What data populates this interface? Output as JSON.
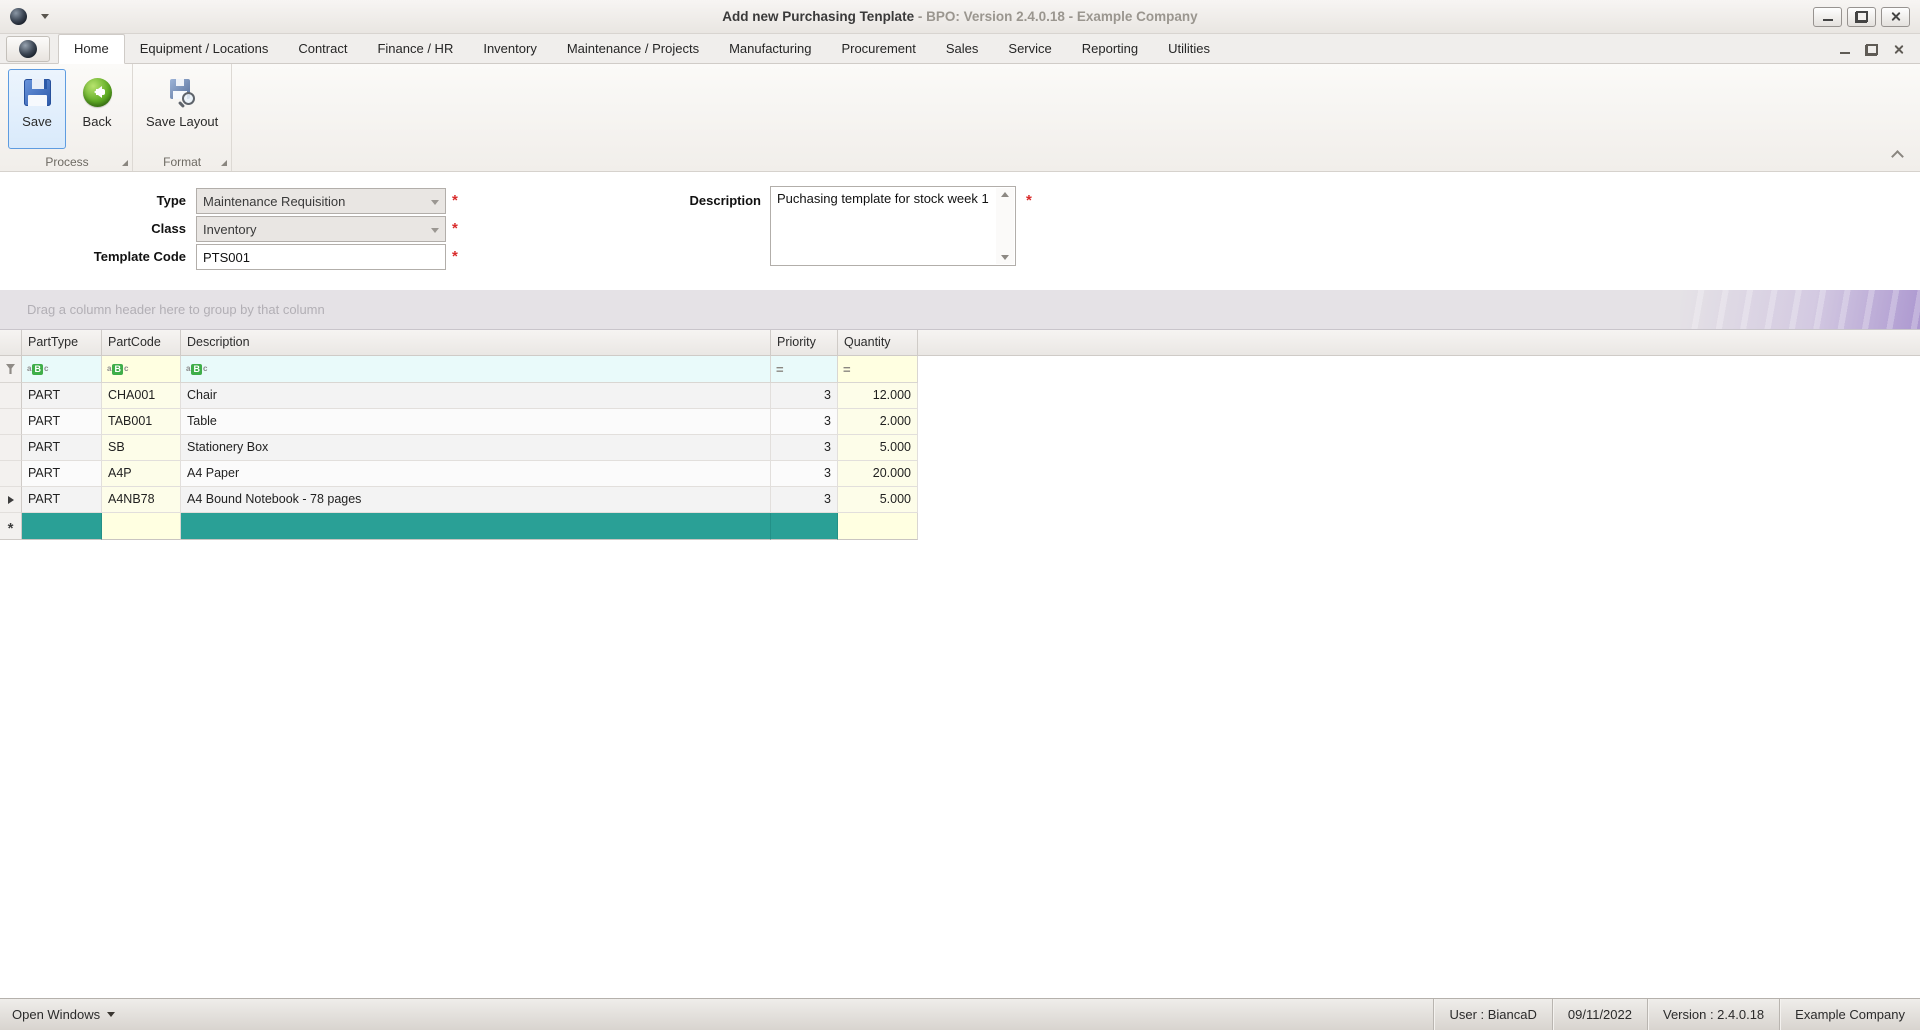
{
  "window": {
    "title_primary": "Add new Purchasing Tenplate",
    "title_secondary": " - BPO: Version 2.4.0.18 - Example Company"
  },
  "ribbon": {
    "tabs": [
      "Home",
      "Equipment / Locations",
      "Contract",
      "Finance / HR",
      "Inventory",
      "Maintenance / Projects",
      "Manufacturing",
      "Procurement",
      "Sales",
      "Service",
      "Reporting",
      "Utilities"
    ],
    "buttons": {
      "save": "Save",
      "back": "Back",
      "save_layout": "Save Layout"
    },
    "groups": {
      "process": "Process",
      "format": "Format"
    }
  },
  "form": {
    "type": {
      "label": "Type",
      "value": "Maintenance Requisition"
    },
    "class": {
      "label": "Class",
      "value": "Inventory"
    },
    "template_code": {
      "label": "Template Code",
      "value": "PTS001"
    },
    "description": {
      "label": "Description",
      "value": "Puchasing template for stock week 1"
    },
    "required_marker": "*"
  },
  "grid": {
    "group_by_hint": "Drag a column header here to group by that column",
    "columns": [
      "PartType",
      "PartCode",
      "Description",
      "Priority",
      "Quantity"
    ],
    "filter": {
      "text_glyph_a": "a",
      "text_glyph_b": "B",
      "text_glyph_c": "c",
      "numeric_glyph": "="
    },
    "new_row_marker": "*",
    "rows": [
      {
        "part_type": "PART",
        "part_code": "CHA001",
        "description": "Chair",
        "priority": "3",
        "quantity": "12.000"
      },
      {
        "part_type": "PART",
        "part_code": "TAB001",
        "description": "Table",
        "priority": "3",
        "quantity": "2.000"
      },
      {
        "part_type": "PART",
        "part_code": "SB",
        "description": "Stationery Box",
        "priority": "3",
        "quantity": "5.000"
      },
      {
        "part_type": "PART",
        "part_code": "A4P",
        "description": "A4 Paper",
        "priority": "3",
        "quantity": "20.000"
      },
      {
        "part_type": "PART",
        "part_code": "A4NB78",
        "description": "A4 Bound Notebook - 78 pages",
        "priority": "3",
        "quantity": "5.000"
      }
    ]
  },
  "status_bar": {
    "open_windows": "Open Windows",
    "user": "User : BiancaD",
    "date": "09/11/2022",
    "version": "Version : 2.4.0.18",
    "company": "Example Company"
  },
  "colors": {
    "new_row_teal": "#2AA096",
    "editable_yellow": "#FFFFE1",
    "filter_cyan": "#E9FAFA",
    "required_red": "#D92B2B",
    "selection_blue": "#5E9CE0"
  }
}
